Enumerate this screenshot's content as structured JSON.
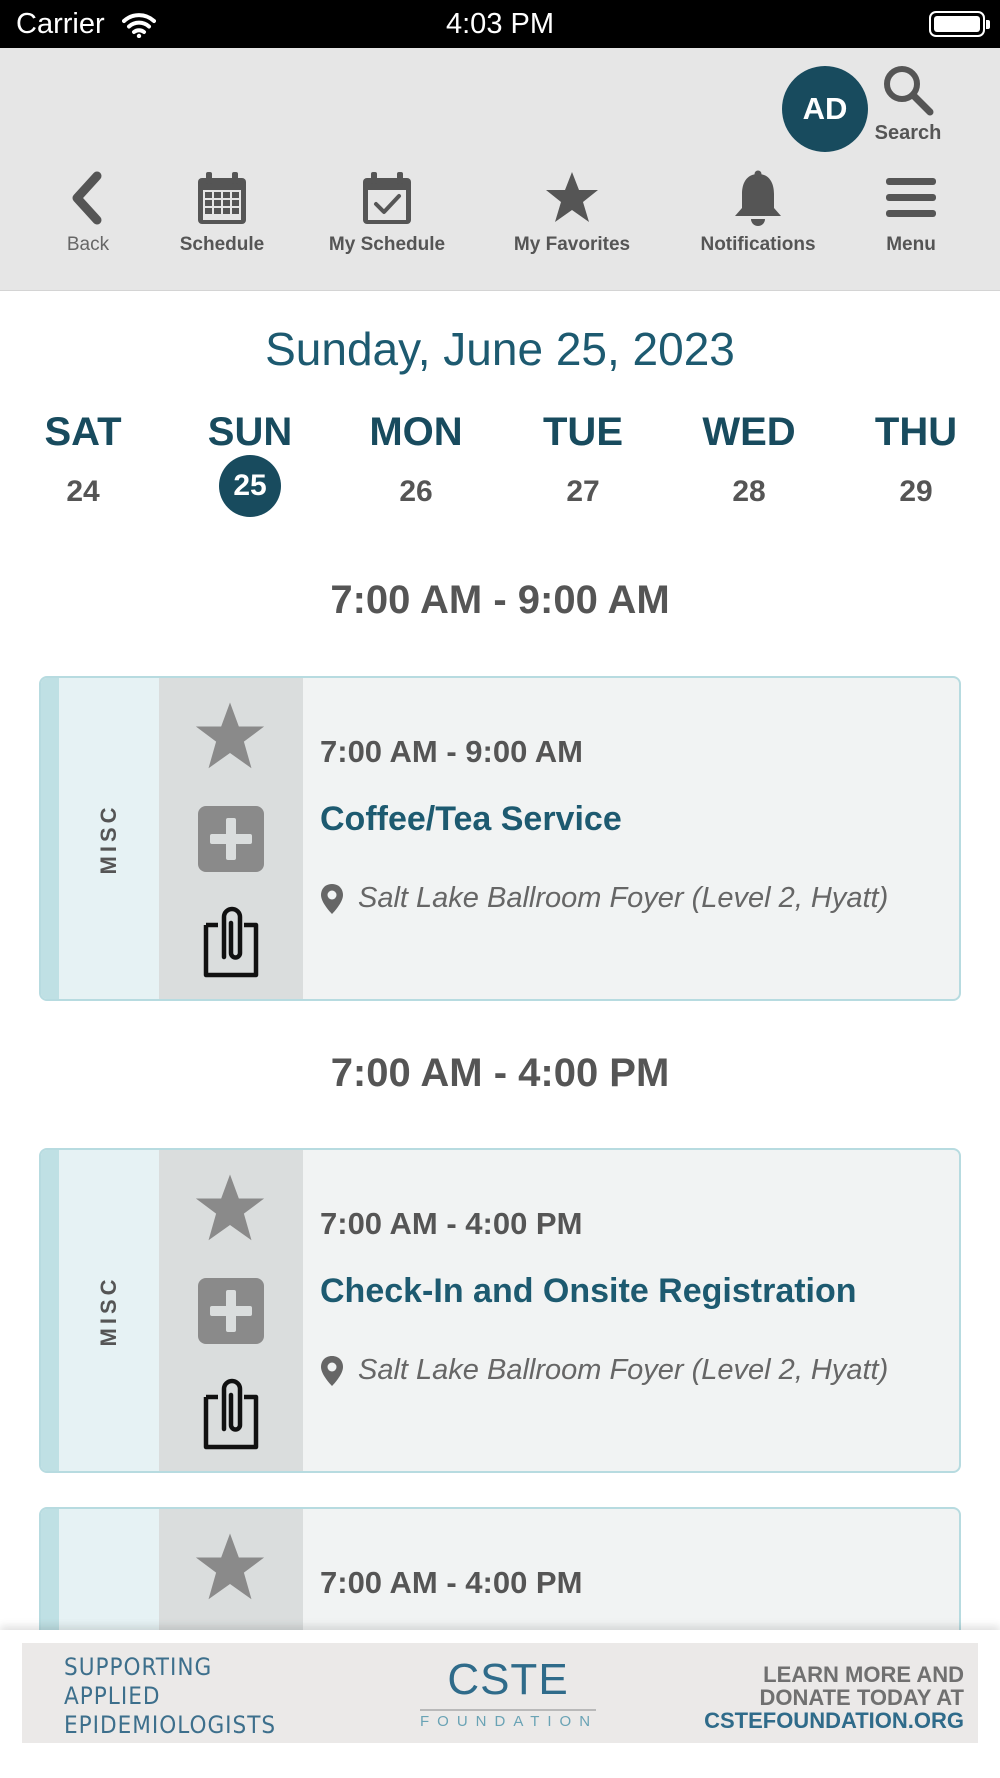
{
  "status_bar": {
    "carrier": "Carrier",
    "time": "4:03 PM"
  },
  "header": {
    "avatar_initials": "AD",
    "search_label": "Search",
    "nav": {
      "back": "Back",
      "schedule": "Schedule",
      "my_schedule": "My Schedule",
      "my_favorites": "My Favorites",
      "notifications": "Notifications",
      "menu": "Menu"
    }
  },
  "date_title": "Sunday, June 25, 2023",
  "days": [
    {
      "name": "SAT",
      "num": "24"
    },
    {
      "name": "SUN",
      "num": "25",
      "selected": true
    },
    {
      "name": "MON",
      "num": "26"
    },
    {
      "name": "TUE",
      "num": "27"
    },
    {
      "name": "WED",
      "num": "28"
    },
    {
      "name": "THU",
      "num": "29"
    }
  ],
  "time_headers": [
    "7:00 AM - 9:00 AM",
    "7:00 AM - 4:00 PM"
  ],
  "sessions": [
    {
      "category": "MISC",
      "time": "7:00 AM - 9:00 AM",
      "title": "Coffee/Tea Service",
      "location": "Salt Lake Ballroom Foyer (Level 2, Hyatt)"
    },
    {
      "category": "MISC",
      "time": "7:00 AM - 4:00 PM",
      "title": "Check-In and Onsite Registration",
      "location": "Salt Lake Ballroom Foyer (Level 2, Hyatt)"
    },
    {
      "time": "7:00 AM - 4:00 PM"
    }
  ],
  "banner": {
    "left_line1": "SUPPORTING",
    "left_line2": "APPLIED",
    "left_line3": "EPIDEMIOLOGISTS",
    "logo": "CSTE",
    "logo_sub": "FOUNDATION",
    "right_line1": "LEARN MORE AND",
    "right_line2": "DONATE TODAY AT",
    "right_line3": "CSTEFOUNDATION.ORG"
  },
  "colors": {
    "primary": "#184b5e",
    "title": "#1d5a70",
    "card_border": "#b7dbe0",
    "accent_strip": "#bfe0e4"
  }
}
